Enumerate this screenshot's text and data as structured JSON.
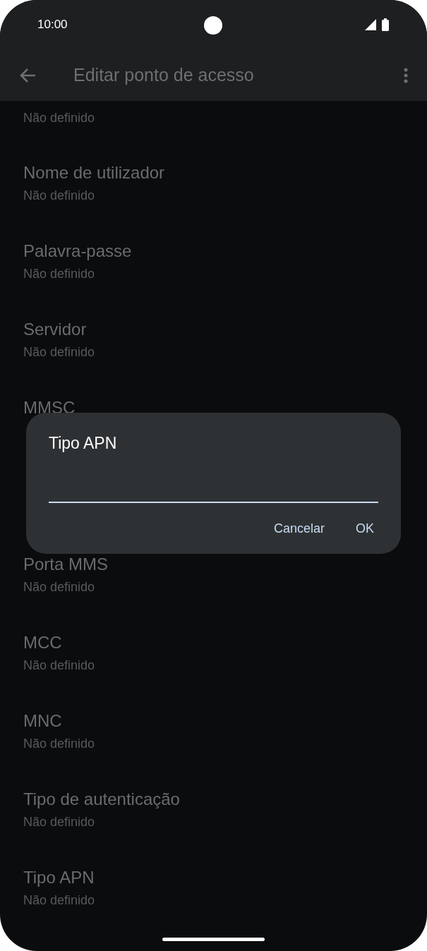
{
  "status_bar": {
    "time": "10:00"
  },
  "app_bar": {
    "title": "Editar ponto de acesso"
  },
  "settings": [
    {
      "subtitle": "Não definido"
    },
    {
      "title": "Nome de utilizador",
      "subtitle": "Não definido"
    },
    {
      "title": "Palavra-passe",
      "subtitle": "Não definido"
    },
    {
      "title": "Servidor",
      "subtitle": "Não definido"
    },
    {
      "title": "MMSC"
    },
    {
      "title": "Porta MMS",
      "subtitle": "Não definido"
    },
    {
      "title": "MCC",
      "subtitle": "Não definido"
    },
    {
      "title": "MNC",
      "subtitle": "Não definido"
    },
    {
      "title": "Tipo de autenticação",
      "subtitle": "Não definido"
    },
    {
      "title": "Tipo APN",
      "subtitle": "Não definido"
    }
  ],
  "dialog": {
    "title": "Tipo APN",
    "buttons": [
      "Cancelar",
      "OK"
    ]
  }
}
